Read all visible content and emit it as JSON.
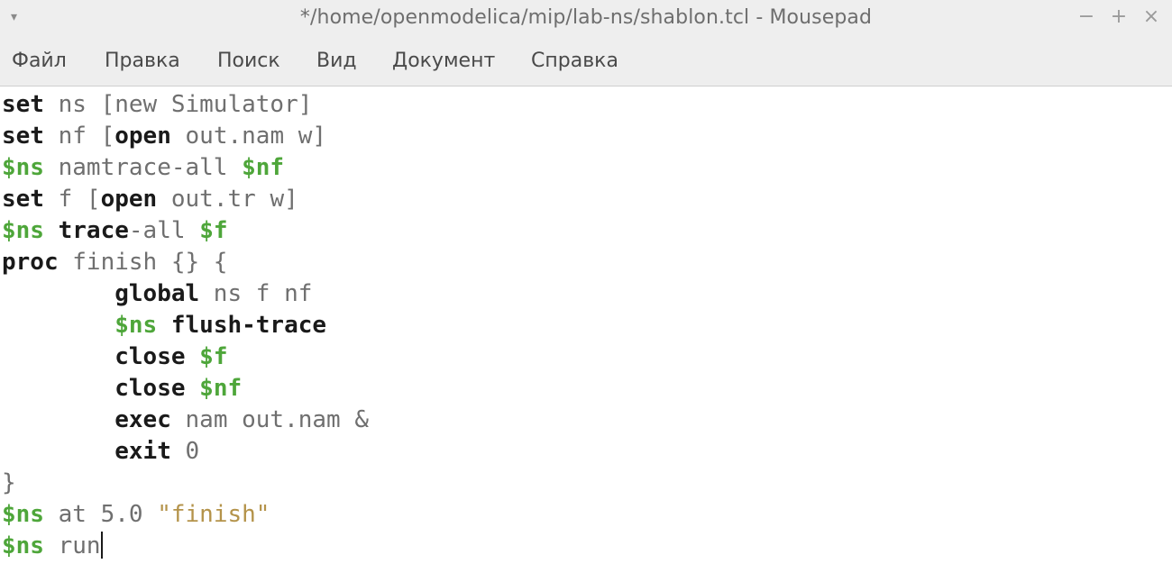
{
  "window": {
    "title": "*/home/openmodelica/mip/lab-ns/shablon.tcl - Mousepad",
    "controls": {
      "minimize": "−",
      "maximize": "+",
      "close": "×"
    },
    "menu_arrow": "▾"
  },
  "menu": {
    "items": [
      {
        "label": "Файл"
      },
      {
        "label": "Правка"
      },
      {
        "label": "Поиск"
      },
      {
        "label": "Вид"
      },
      {
        "label": "Документ"
      },
      {
        "label": "Справка"
      }
    ]
  },
  "colors": {
    "keyword": "#1a1a1a",
    "variable": "#4ea63a",
    "string": "#b4934a",
    "plain": "#6f6f6f"
  },
  "editor": {
    "lines": [
      {
        "tokens": [
          {
            "t": "set",
            "c": "kw"
          },
          {
            "t": " ns [new Simulator]",
            "c": "plain"
          }
        ]
      },
      {
        "tokens": [
          {
            "t": "set",
            "c": "kw"
          },
          {
            "t": " nf [",
            "c": "plain"
          },
          {
            "t": "open",
            "c": "kw"
          },
          {
            "t": " out.nam w]",
            "c": "plain"
          }
        ]
      },
      {
        "tokens": [
          {
            "t": "$ns",
            "c": "var"
          },
          {
            "t": " namtrace-all ",
            "c": "plain"
          },
          {
            "t": "$nf",
            "c": "var"
          }
        ]
      },
      {
        "tokens": [
          {
            "t": "set",
            "c": "kw"
          },
          {
            "t": " f [",
            "c": "plain"
          },
          {
            "t": "open",
            "c": "kw"
          },
          {
            "t": " out.tr w]",
            "c": "plain"
          }
        ]
      },
      {
        "tokens": [
          {
            "t": "$ns",
            "c": "var"
          },
          {
            "t": " ",
            "c": "plain"
          },
          {
            "t": "trace",
            "c": "kw"
          },
          {
            "t": "-all ",
            "c": "plain"
          },
          {
            "t": "$f",
            "c": "var"
          }
        ]
      },
      {
        "tokens": [
          {
            "t": "proc",
            "c": "kw"
          },
          {
            "t": " finish {} {",
            "c": "plain"
          }
        ]
      },
      {
        "tokens": [
          {
            "t": "        ",
            "c": "plain"
          },
          {
            "t": "global",
            "c": "kw"
          },
          {
            "t": " ns f nf",
            "c": "plain"
          }
        ]
      },
      {
        "tokens": [
          {
            "t": "        ",
            "c": "plain"
          },
          {
            "t": "$ns",
            "c": "var"
          },
          {
            "t": " ",
            "c": "plain"
          },
          {
            "t": "flush-trace",
            "c": "kw"
          }
        ]
      },
      {
        "tokens": [
          {
            "t": "        ",
            "c": "plain"
          },
          {
            "t": "close",
            "c": "kw"
          },
          {
            "t": " ",
            "c": "plain"
          },
          {
            "t": "$f",
            "c": "var"
          }
        ]
      },
      {
        "tokens": [
          {
            "t": "        ",
            "c": "plain"
          },
          {
            "t": "close",
            "c": "kw"
          },
          {
            "t": " ",
            "c": "plain"
          },
          {
            "t": "$nf",
            "c": "var"
          }
        ]
      },
      {
        "tokens": [
          {
            "t": "        ",
            "c": "plain"
          },
          {
            "t": "exec",
            "c": "kw"
          },
          {
            "t": " nam out.nam &",
            "c": "plain"
          }
        ]
      },
      {
        "tokens": [
          {
            "t": "        ",
            "c": "plain"
          },
          {
            "t": "exit",
            "c": "kw"
          },
          {
            "t": " 0",
            "c": "num"
          }
        ]
      },
      {
        "tokens": [
          {
            "t": "}",
            "c": "plain"
          }
        ]
      },
      {
        "tokens": [
          {
            "t": "$ns",
            "c": "var"
          },
          {
            "t": " at 5.0 ",
            "c": "plain"
          },
          {
            "t": "\"finish\"",
            "c": "str"
          }
        ]
      },
      {
        "tokens": [
          {
            "t": "$ns",
            "c": "var"
          },
          {
            "t": " run",
            "c": "plain"
          }
        ]
      }
    ],
    "cursor_line": 15
  }
}
